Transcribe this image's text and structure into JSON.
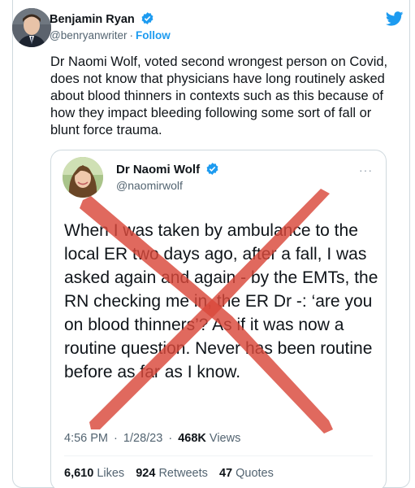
{
  "tweet": {
    "author_name": "Benjamin Ryan",
    "author_handle": "@benryanwriter",
    "separator": "·",
    "follow_label": "Follow",
    "text": "Dr Naomi Wolf, voted second wrongest person on Covid, does not know that physicians have long routinely asked about blood thinners in contexts such as this because of how they impact bleeding following some sort of fall or blunt force trauma."
  },
  "quoted": {
    "author_name": "Dr Naomi Wolf",
    "author_handle": "@naomirwolf",
    "more": "···",
    "text": "When I was taken by ambulance to the local ER two days ago, after a fall, I was asked again and again - by the EMTs, the RN checking me in, the ER Dr -: ‘are you on blood thinners’? As if it was now a routine question. Never has been routine before as far as I know.",
    "time": "4:56 PM",
    "date": "1/28/23",
    "views_count": "468K",
    "views_label": "Views",
    "likes_count": "6,610",
    "likes_label": "Likes",
    "retweets_count": "924",
    "retweets_label": "Retweets",
    "quotes_count": "47",
    "quotes_label": "Quotes"
  },
  "colors": {
    "twitter_blue": "#1d9bf0",
    "cross_red": "#d9483b"
  },
  "icons": [
    "verified-icon",
    "twitter-bird-icon",
    "more-icon"
  ]
}
